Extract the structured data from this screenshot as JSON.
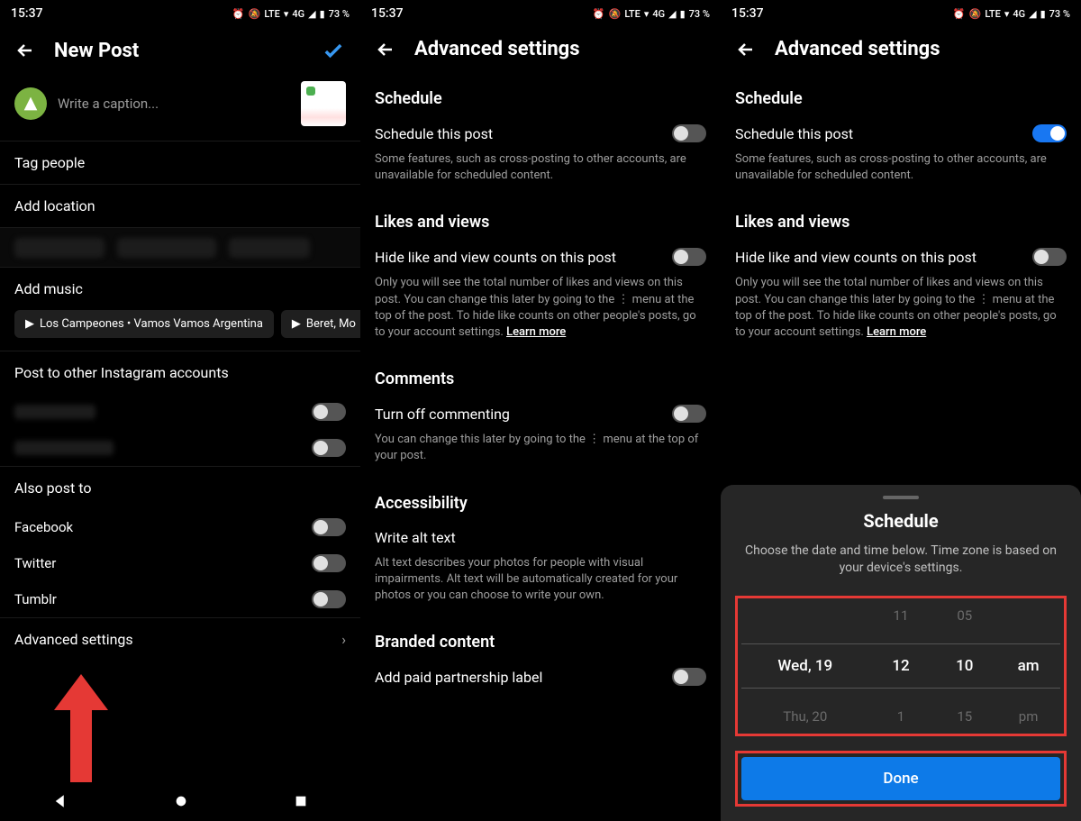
{
  "status": {
    "time": "15:37",
    "lte": "LTE",
    "net": "4G",
    "battery": "73 %",
    "battery2": "73 %"
  },
  "screen1": {
    "title": "New Post",
    "caption_placeholder": "Write a caption...",
    "tag_people": "Tag people",
    "add_location": "Add location",
    "add_music": "Add music",
    "chip1": "Los Campeones • Vamos Vamos Argentina",
    "chip2": "Beret, Mo",
    "post_other": "Post to other Instagram accounts",
    "also_post": "Also post to",
    "facebook": "Facebook",
    "twitter": "Twitter",
    "tumblr": "Tumblr",
    "advanced": "Advanced settings"
  },
  "screen2": {
    "title": "Advanced settings",
    "schedule": "Schedule",
    "schedule_post": "Schedule this post",
    "schedule_desc": "Some features, such as cross-posting to other accounts, are unavailable for scheduled content.",
    "likes_views": "Likes and views",
    "hide_counts": "Hide like and view counts on this post",
    "hide_desc": "Only you will see the total number of likes and views on this post. You can change this later by going to the ⋮ menu at the top of the post. To hide like counts on other people's posts, go to your account settings. ",
    "learn_more": "Learn more",
    "comments": "Comments",
    "turn_off": "Turn off commenting",
    "turn_off_desc": "You can change this later by going to the  ⋮  menu at the top of your post.",
    "accessibility": "Accessibility",
    "alt_text": "Write alt text",
    "alt_desc": "Alt text describes your photos for people with visual impairments. Alt text will be automatically created for your photos or you can choose to write your own.",
    "branded": "Branded content",
    "paid_label": "Add paid partnership label"
  },
  "sheet": {
    "title": "Schedule",
    "desc": "Choose the date and time below. Time zone is based on your device's settings.",
    "row_above": [
      "",
      "11",
      "05",
      ""
    ],
    "row_sel": [
      "Wed, 19",
      "12",
      "10",
      "am"
    ],
    "row_below": [
      "Thu, 20",
      "1",
      "15",
      "pm"
    ],
    "done": "Done"
  }
}
